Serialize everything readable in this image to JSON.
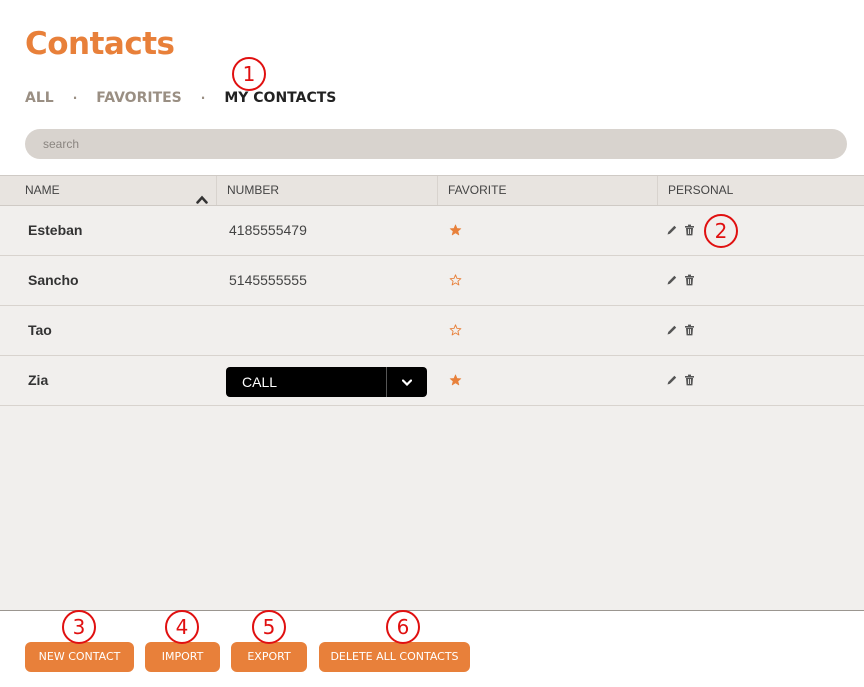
{
  "title": "Contacts",
  "tabs": [
    {
      "label": "ALL"
    },
    {
      "label": "FAVORITES"
    },
    {
      "label": "MY CONTACTS"
    }
  ],
  "tab_separator": "·",
  "search": {
    "placeholder": "search"
  },
  "columns": {
    "name": "NAME",
    "number": "NUMBER",
    "favorite": "FAVORITE",
    "personal": "PERSONAL"
  },
  "rows": [
    {
      "name": "Esteban",
      "number": "4185555479",
      "favorite": true
    },
    {
      "name": "Sancho",
      "number": "5145555555",
      "favorite": false
    },
    {
      "name": "Tao",
      "number": "",
      "favorite": false
    },
    {
      "name": "Zia",
      "number": "",
      "favorite": true
    }
  ],
  "call_label": "CALL",
  "buttons": {
    "new_contact": "NEW CONTACT",
    "import": "IMPORT",
    "export": "EXPORT",
    "delete_all": "DELETE ALL CONTACTS"
  },
  "markers": [
    "1",
    "2",
    "3",
    "4",
    "5",
    "6"
  ],
  "icons": {
    "sort": "chevron-up-icon",
    "edit": "pencil-icon",
    "delete": "trash-icon",
    "favorite": "star-icon",
    "caret": "chevron-down-icon"
  },
  "colors": {
    "accent": "#e8803a",
    "marker": "#e01010",
    "active_tab": "#222222",
    "inactive_tab": "#9a8f83"
  }
}
